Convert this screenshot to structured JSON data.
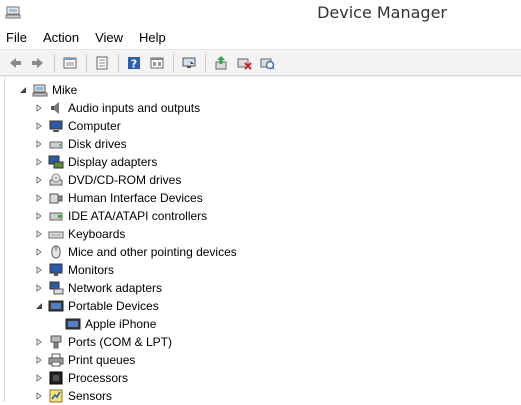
{
  "window": {
    "title": "Device Manager"
  },
  "menu": {
    "file": "File",
    "action": "Action",
    "view": "View",
    "help": "Help"
  },
  "toolbar": {
    "buttons": [
      "back-icon",
      "forward-icon",
      "properties-icon",
      "list-icon",
      "help-icon",
      "view-icon",
      "monitor-icon",
      "update-driver-icon",
      "uninstall-icon",
      "scan-hardware-icon"
    ]
  },
  "tree": {
    "root": "Mike",
    "items": [
      {
        "label": "Audio inputs and outputs",
        "icon": "speaker-icon"
      },
      {
        "label": "Computer",
        "icon": "computer-icon"
      },
      {
        "label": "Disk drives",
        "icon": "disk-drive-icon"
      },
      {
        "label": "Display adapters",
        "icon": "display-adapter-icon"
      },
      {
        "label": "DVD/CD-ROM drives",
        "icon": "dvd-drive-icon"
      },
      {
        "label": "Human Interface Devices",
        "icon": "hid-icon"
      },
      {
        "label": "IDE ATA/ATAPI controllers",
        "icon": "ide-controller-icon"
      },
      {
        "label": "Keyboards",
        "icon": "keyboard-icon"
      },
      {
        "label": "Mice and other pointing devices",
        "icon": "mouse-icon"
      },
      {
        "label": "Monitors",
        "icon": "monitor-icon"
      },
      {
        "label": "Network adapters",
        "icon": "network-adapter-icon"
      },
      {
        "label": "Portable Devices",
        "icon": "portable-device-icon"
      },
      {
        "label": "Apple iPhone",
        "icon": "phone-device-icon"
      },
      {
        "label": "Ports (COM & LPT)",
        "icon": "port-icon"
      },
      {
        "label": "Print queues",
        "icon": "printer-icon"
      },
      {
        "label": "Processors",
        "icon": "processor-icon"
      },
      {
        "label": "Sensors",
        "icon": "sensor-icon"
      }
    ]
  }
}
